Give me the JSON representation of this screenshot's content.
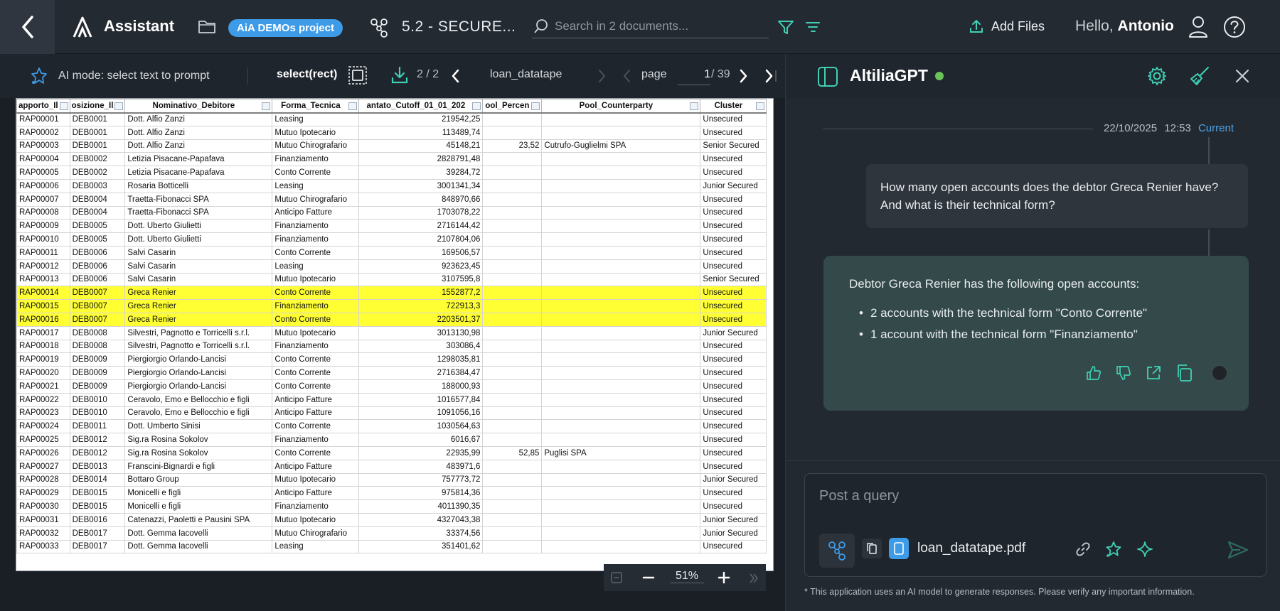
{
  "header": {
    "app_title": "Assistant",
    "project_badge": "AiA DEMOs project",
    "doc_title": "5.2 - SECURE...",
    "search_placeholder": "Search in 2 documents...",
    "add_files": "Add Files",
    "greeting": "Hello,",
    "user_name": "Antonio"
  },
  "viewer": {
    "ai_mode": "AI mode: select text to prompt",
    "select_mode": "select(rect)",
    "doc_index": "2 / 2",
    "file_label": "loan_datatape",
    "page_word": "page",
    "page_current": "1",
    "page_total": "/ 39",
    "zoom": "51%"
  },
  "sheet": {
    "columns": [
      "apporto_Il",
      "osizione_Il",
      "Nominativo_Debitore",
      "Forma_Tecnica",
      "antato_Cutoff_01_01_202",
      "ool_Percen",
      "Pool_Counterparty",
      "Cluster"
    ],
    "rows": [
      [
        "RAP00001",
        "DEB0001",
        "Dott. Alfio Zanzi",
        "Leasing",
        "219542,25",
        "",
        "",
        "Unsecured"
      ],
      [
        "RAP00002",
        "DEB0001",
        "Dott. Alfio Zanzi",
        "Mutuo Ipotecario",
        "113489,74",
        "",
        "",
        "Unsecured"
      ],
      [
        "RAP00003",
        "DEB0001",
        "Dott. Alfio Zanzi",
        "Mutuo Chirografario",
        "45148,21",
        "23,52",
        "Cutrufo-Guglielmi SPA",
        "Senior Secured"
      ],
      [
        "RAP00004",
        "DEB0002",
        "Letizia Pisacane-Papafava",
        "Finanziamento",
        "2828791,48",
        "",
        "",
        "Unsecured"
      ],
      [
        "RAP00005",
        "DEB0002",
        "Letizia Pisacane-Papafava",
        "Conto Corrente",
        "39284,72",
        "",
        "",
        "Unsecured"
      ],
      [
        "RAP00006",
        "DEB0003",
        "Rosaria Botticelli",
        "Leasing",
        "3001341,34",
        "",
        "",
        "Junior Secured"
      ],
      [
        "RAP00007",
        "DEB0004",
        "Traetta-Fibonacci SPA",
        "Mutuo Chirografario",
        "848970,66",
        "",
        "",
        "Unsecured"
      ],
      [
        "RAP00008",
        "DEB0004",
        "Traetta-Fibonacci SPA",
        "Anticipo Fatture",
        "1703078,22",
        "",
        "",
        "Unsecured"
      ],
      [
        "RAP00009",
        "DEB0005",
        "Dott. Uberto Giulietti",
        "Finanziamento",
        "2716144,42",
        "",
        "",
        "Unsecured"
      ],
      [
        "RAP00010",
        "DEB0005",
        "Dott. Uberto Giulietti",
        "Finanziamento",
        "2107804,06",
        "",
        "",
        "Unsecured"
      ],
      [
        "RAP00011",
        "DEB0006",
        "Salvi Casarin",
        "Conto Corrente",
        "169506,57",
        "",
        "",
        "Unsecured"
      ],
      [
        "RAP00012",
        "DEB0006",
        "Salvi Casarin",
        "Leasing",
        "923623,45",
        "",
        "",
        "Unsecured"
      ],
      [
        "RAP00013",
        "DEB0006",
        "Salvi Casarin",
        "Mutuo Ipotecario",
        "3107595,8",
        "",
        "",
        "Senior Secured"
      ],
      [
        "RAP00014",
        "DEB0007",
        "Greca Renier",
        "Conto Corrente",
        "1552877,2",
        "",
        "",
        "Unsecured"
      ],
      [
        "RAP00015",
        "DEB0007",
        "Greca Renier",
        "Finanziamento",
        "722913,3",
        "",
        "",
        "Unsecured"
      ],
      [
        "RAP00016",
        "DEB0007",
        "Greca Renier",
        "Conto Corrente",
        "2203501,37",
        "",
        "",
        "Unsecured"
      ],
      [
        "RAP00017",
        "DEB0008",
        "Silvestri, Pagnotto e Torricelli s.r.l.",
        "Mutuo Ipotecario",
        "3013130,98",
        "",
        "",
        "Junior Secured"
      ],
      [
        "RAP00018",
        "DEB0008",
        "Silvestri, Pagnotto e Torricelli s.r.l.",
        "Finanziamento",
        "303086,4",
        "",
        "",
        "Unsecured"
      ],
      [
        "RAP00019",
        "DEB0009",
        "Piergiorgio Orlando-Lancisi",
        "Conto Corrente",
        "1298035,81",
        "",
        "",
        "Unsecured"
      ],
      [
        "RAP00020",
        "DEB0009",
        "Piergiorgio Orlando-Lancisi",
        "Conto Corrente",
        "2716384,47",
        "",
        "",
        "Unsecured"
      ],
      [
        "RAP00021",
        "DEB0009",
        "Piergiorgio Orlando-Lancisi",
        "Conto Corrente",
        "188000,93",
        "",
        "",
        "Unsecured"
      ],
      [
        "RAP00022",
        "DEB0010",
        "Ceravolo, Emo e Bellocchio e figli",
        "Anticipo Fatture",
        "1016577,84",
        "",
        "",
        "Unsecured"
      ],
      [
        "RAP00023",
        "DEB0010",
        "Ceravolo, Emo e Bellocchio e figli",
        "Anticipo Fatture",
        "1091056,16",
        "",
        "",
        "Unsecured"
      ],
      [
        "RAP00024",
        "DEB0011",
        "Dott. Umberto Sinisi",
        "Conto Corrente",
        "1030564,63",
        "",
        "",
        "Unsecured"
      ],
      [
        "RAP00025",
        "DEB0012",
        "Sig.ra Rosina Sokolov",
        "Finanziamento",
        "6016,67",
        "",
        "",
        "Unsecured"
      ],
      [
        "RAP00026",
        "DEB0012",
        "Sig.ra Rosina Sokolov",
        "Conto Corrente",
        "22935,99",
        "52,85",
        "Puglisi SPA",
        "Unsecured"
      ],
      [
        "RAP00027",
        "DEB0013",
        "Franscini-Bignardi e figli",
        "Anticipo Fatture",
        "483971,6",
        "",
        "",
        "Unsecured"
      ],
      [
        "RAP00028",
        "DEB0014",
        "Bottaro Group",
        "Mutuo Ipotecario",
        "757773,72",
        "",
        "",
        "Junior Secured"
      ],
      [
        "RAP00029",
        "DEB0015",
        "Monicelli e figli",
        "Anticipo Fatture",
        "975814,36",
        "",
        "",
        "Unsecured"
      ],
      [
        "RAP00030",
        "DEB0015",
        "Monicelli e figli",
        "Finanziamento",
        "4011390,35",
        "",
        "",
        "Unsecured"
      ],
      [
        "RAP00031",
        "DEB0016",
        "Catenazzi, Paoletti e Pausini SPA",
        "Mutuo Ipotecario",
        "4327043,38",
        "",
        "",
        "Junior Secured"
      ],
      [
        "RAP00032",
        "DEB0017",
        "Dott. Gemma Iacovelli",
        "Mutuo Chirografario",
        "33374,56",
        "",
        "",
        "Junior Secured"
      ],
      [
        "RAP00033",
        "DEB0017",
        "Dott. Gemma Iacovelli",
        "Leasing",
        "351401,62",
        "",
        "",
        "Unsecured"
      ]
    ],
    "highlighted_rows": [
      "RAP00014",
      "RAP00015",
      "RAP00016"
    ],
    "highlight_color": "#ffff33"
  },
  "chat": {
    "title": "AltiliaGPT",
    "status_color": "#6ac259",
    "date": "22/10/2025",
    "time": "12:53",
    "current_label": "Current",
    "user_message": "How many open accounts does the debtor Greca Renier have? And what is their technical form?",
    "bot_intro": "Debtor Greca Renier has the following open accounts:",
    "bot_items": [
      "2 accounts with the technical form \"Conto Corrente\"",
      "1 account with the technical form \"Finanziamento\""
    ],
    "query_placeholder": "Post a query",
    "attached_file": "loan_datatape.pdf",
    "disclaimer": "* This application uses an AI model to generate responses. Please verify any important information."
  },
  "colors": {
    "accent_blue": "#3d9be8",
    "accent_teal": "#3fd1b5",
    "bot_bubble": "#34494a"
  },
  "icons": [
    "back-icon",
    "logo-icon",
    "folder-icon",
    "graph-icon",
    "search-icon",
    "filter-icon",
    "sort-icon",
    "upload-icon",
    "user-icon",
    "help-icon",
    "ai-star-icon",
    "rect-select-icon",
    "download-icon",
    "chevron-left-icon",
    "chevron-right-icon",
    "panel-icon",
    "gear-icon",
    "broom-icon",
    "close-icon",
    "thumbs-up-icon",
    "thumbs-down-icon",
    "share-icon",
    "copy-icon",
    "link-icon",
    "star-icon",
    "sparkle-icon",
    "send-icon"
  ]
}
